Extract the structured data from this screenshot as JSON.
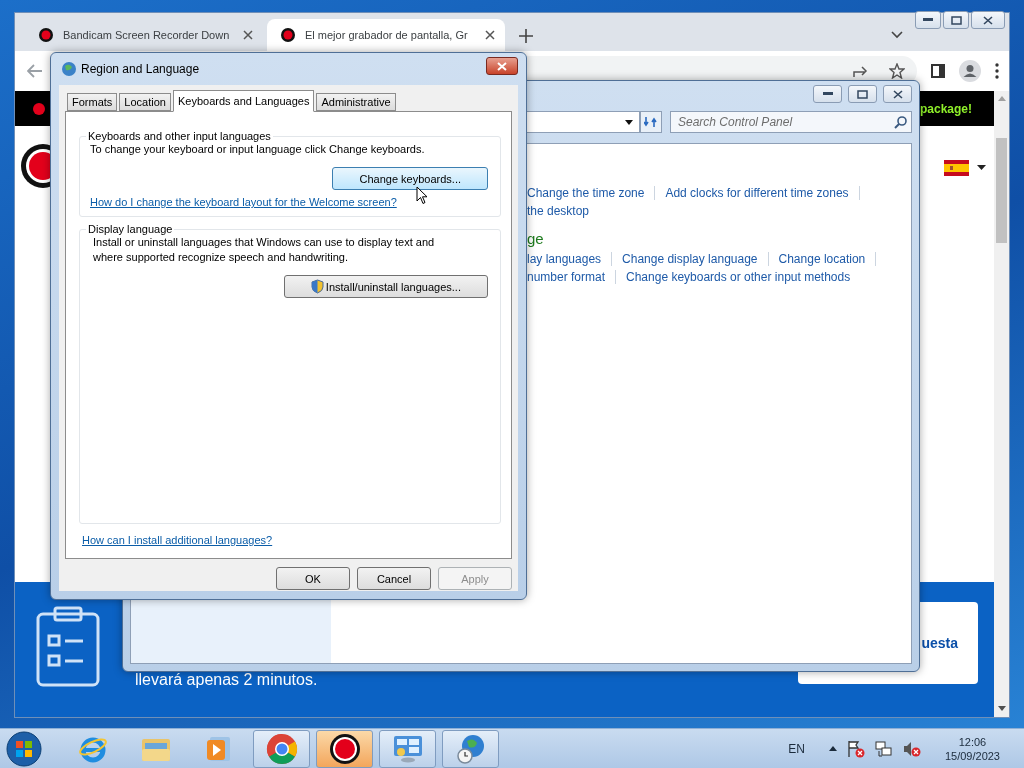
{
  "browser": {
    "tabs": [
      {
        "title": "Bandicam Screen Recorder Down",
        "selected": false
      },
      {
        "title": "El mejor grabador de pantalla, Gr",
        "selected": true
      }
    ],
    "banner_text": "package!",
    "bottom_text": "llevará apenas 2 minutos.",
    "card_text": "uesta"
  },
  "control_panel": {
    "search": {
      "placeholder": "Search Control Panel"
    },
    "lines": [
      {
        "kind": "links",
        "links": [
          "Change the time zone",
          "Add clocks for different time zones"
        ],
        "trailing_separator": true
      },
      {
        "kind": "links",
        "links": [
          "the desktop"
        ],
        "trailing_separator": false
      },
      {
        "kind": "heading",
        "text": "ge"
      },
      {
        "kind": "links",
        "links": [
          "lay languages",
          "Change display language",
          "Change location"
        ],
        "trailing_separator": true
      },
      {
        "kind": "links",
        "links": [
          "number format",
          "Change keyboards or other input methods"
        ],
        "trailing_separator": false
      }
    ]
  },
  "dialog": {
    "title": "Region and Language",
    "tabs": [
      {
        "label": "Formats",
        "selected": false
      },
      {
        "label": "Location",
        "selected": false
      },
      {
        "label": "Keyboards and Languages",
        "selected": true
      },
      {
        "label": "Administrative",
        "selected": false
      }
    ],
    "groups": [
      {
        "title": "Keyboards and other input languages",
        "text": "To change your keyboard or input language click Change keyboards.",
        "button": {
          "label": "Change keyboards...",
          "hovered": true,
          "shield": false
        },
        "link": "How do I change the keyboard layout for the Welcome screen?"
      },
      {
        "title": "Display language",
        "text": "Install or uninstall languages that Windows can use to display text and where supported recognize speech and handwriting.",
        "button": {
          "label": "Install/uninstall languages...",
          "hovered": false,
          "shield": true
        }
      }
    ],
    "bottom_link": "How can I install additional languages?",
    "buttons": [
      {
        "label": "OK",
        "disabled": false
      },
      {
        "label": "Cancel",
        "disabled": false
      },
      {
        "label": "Apply",
        "disabled": true
      }
    ]
  },
  "taskbar": {
    "items": [
      {
        "kind": "ie",
        "running": false,
        "selected": false
      },
      {
        "kind": "explorer",
        "running": false,
        "selected": false
      },
      {
        "kind": "media",
        "running": false,
        "selected": false
      },
      {
        "kind": "chrome",
        "running": true,
        "selected": false
      },
      {
        "kind": "bandicam",
        "running": true,
        "selected": true
      },
      {
        "kind": "control-panel",
        "running": true,
        "selected": false
      },
      {
        "kind": "region",
        "running": true,
        "selected": false
      }
    ],
    "language": "EN",
    "time": "12:06",
    "date": "15/09/2023"
  }
}
